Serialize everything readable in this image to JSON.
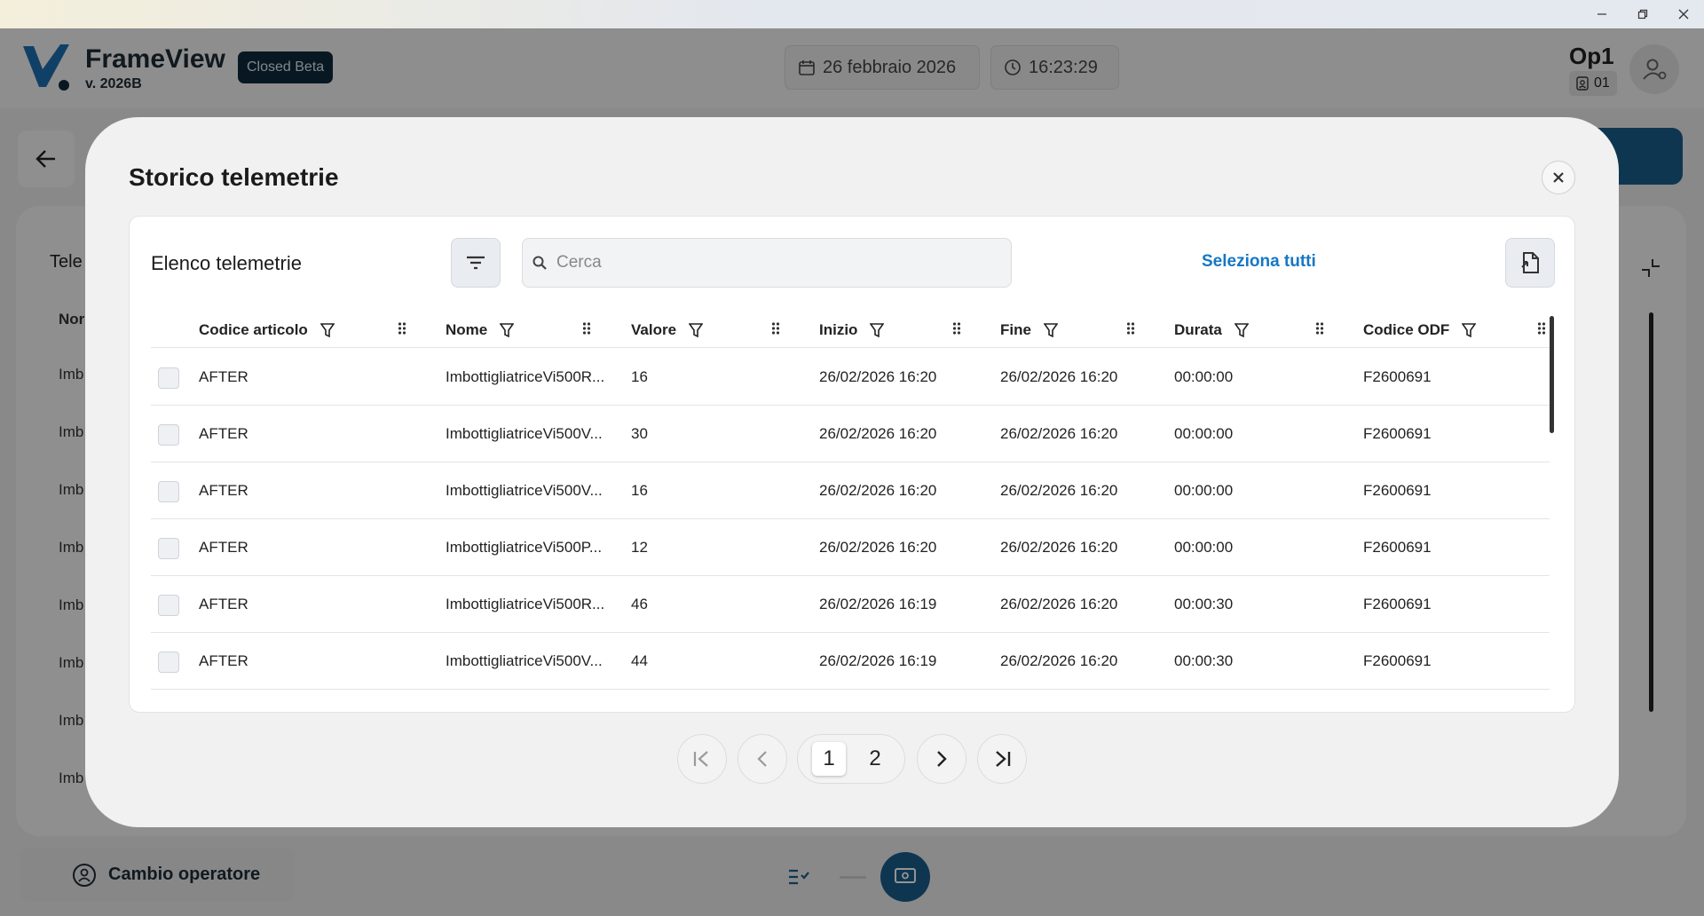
{
  "window": {
    "controls": [
      "minimize",
      "maximize",
      "close"
    ]
  },
  "header": {
    "brand": "FrameView",
    "version": "v. 2026B",
    "beta_badge": "Closed Beta",
    "date": "26 febbraio 2026",
    "time": "16:23:29",
    "operator_name": "Op1",
    "operator_code": "01"
  },
  "background": {
    "card_title": "Tele",
    "column_header": "Nor",
    "row_text": "Imb",
    "bottom_button": "Cambio operatore"
  },
  "modal": {
    "title": "Storico telemetrie",
    "panel_title": "Elenco telemetrie",
    "search_placeholder": "Cerca",
    "select_all": "Seleziona tutti",
    "columns": [
      "Codice articolo",
      "Nome",
      "Valore",
      "Inizio",
      "Fine",
      "Durata",
      "Codice ODF"
    ],
    "rows": [
      {
        "code": "AFTER",
        "name": "ImbottigliatriceVi500R...",
        "value": "16",
        "start": "26/02/2026 16:20",
        "end": "26/02/2026 16:20",
        "duration": "00:00:00",
        "odf": "F2600691"
      },
      {
        "code": "AFTER",
        "name": "ImbottigliatriceVi500V...",
        "value": "30",
        "start": "26/02/2026 16:20",
        "end": "26/02/2026 16:20",
        "duration": "00:00:00",
        "odf": "F2600691"
      },
      {
        "code": "AFTER",
        "name": "ImbottigliatriceVi500V...",
        "value": "16",
        "start": "26/02/2026 16:20",
        "end": "26/02/2026 16:20",
        "duration": "00:00:00",
        "odf": "F2600691"
      },
      {
        "code": "AFTER",
        "name": "ImbottigliatriceVi500P...",
        "value": "12",
        "start": "26/02/2026 16:20",
        "end": "26/02/2026 16:20",
        "duration": "00:00:00",
        "odf": "F2600691"
      },
      {
        "code": "AFTER",
        "name": "ImbottigliatriceVi500R...",
        "value": "46",
        "start": "26/02/2026 16:19",
        "end": "26/02/2026 16:20",
        "duration": "00:00:30",
        "odf": "F2600691"
      },
      {
        "code": "AFTER",
        "name": "ImbottigliatriceVi500V...",
        "value": "44",
        "start": "26/02/2026 16:19",
        "end": "26/02/2026 16:20",
        "duration": "00:00:30",
        "odf": "F2600691"
      }
    ],
    "pagination": {
      "pages": [
        "1",
        "2"
      ],
      "current": "1"
    }
  },
  "colors": {
    "accent": "#1577c4",
    "brand_dark": "#0e2a3d",
    "teal": "#1a5d8a"
  }
}
